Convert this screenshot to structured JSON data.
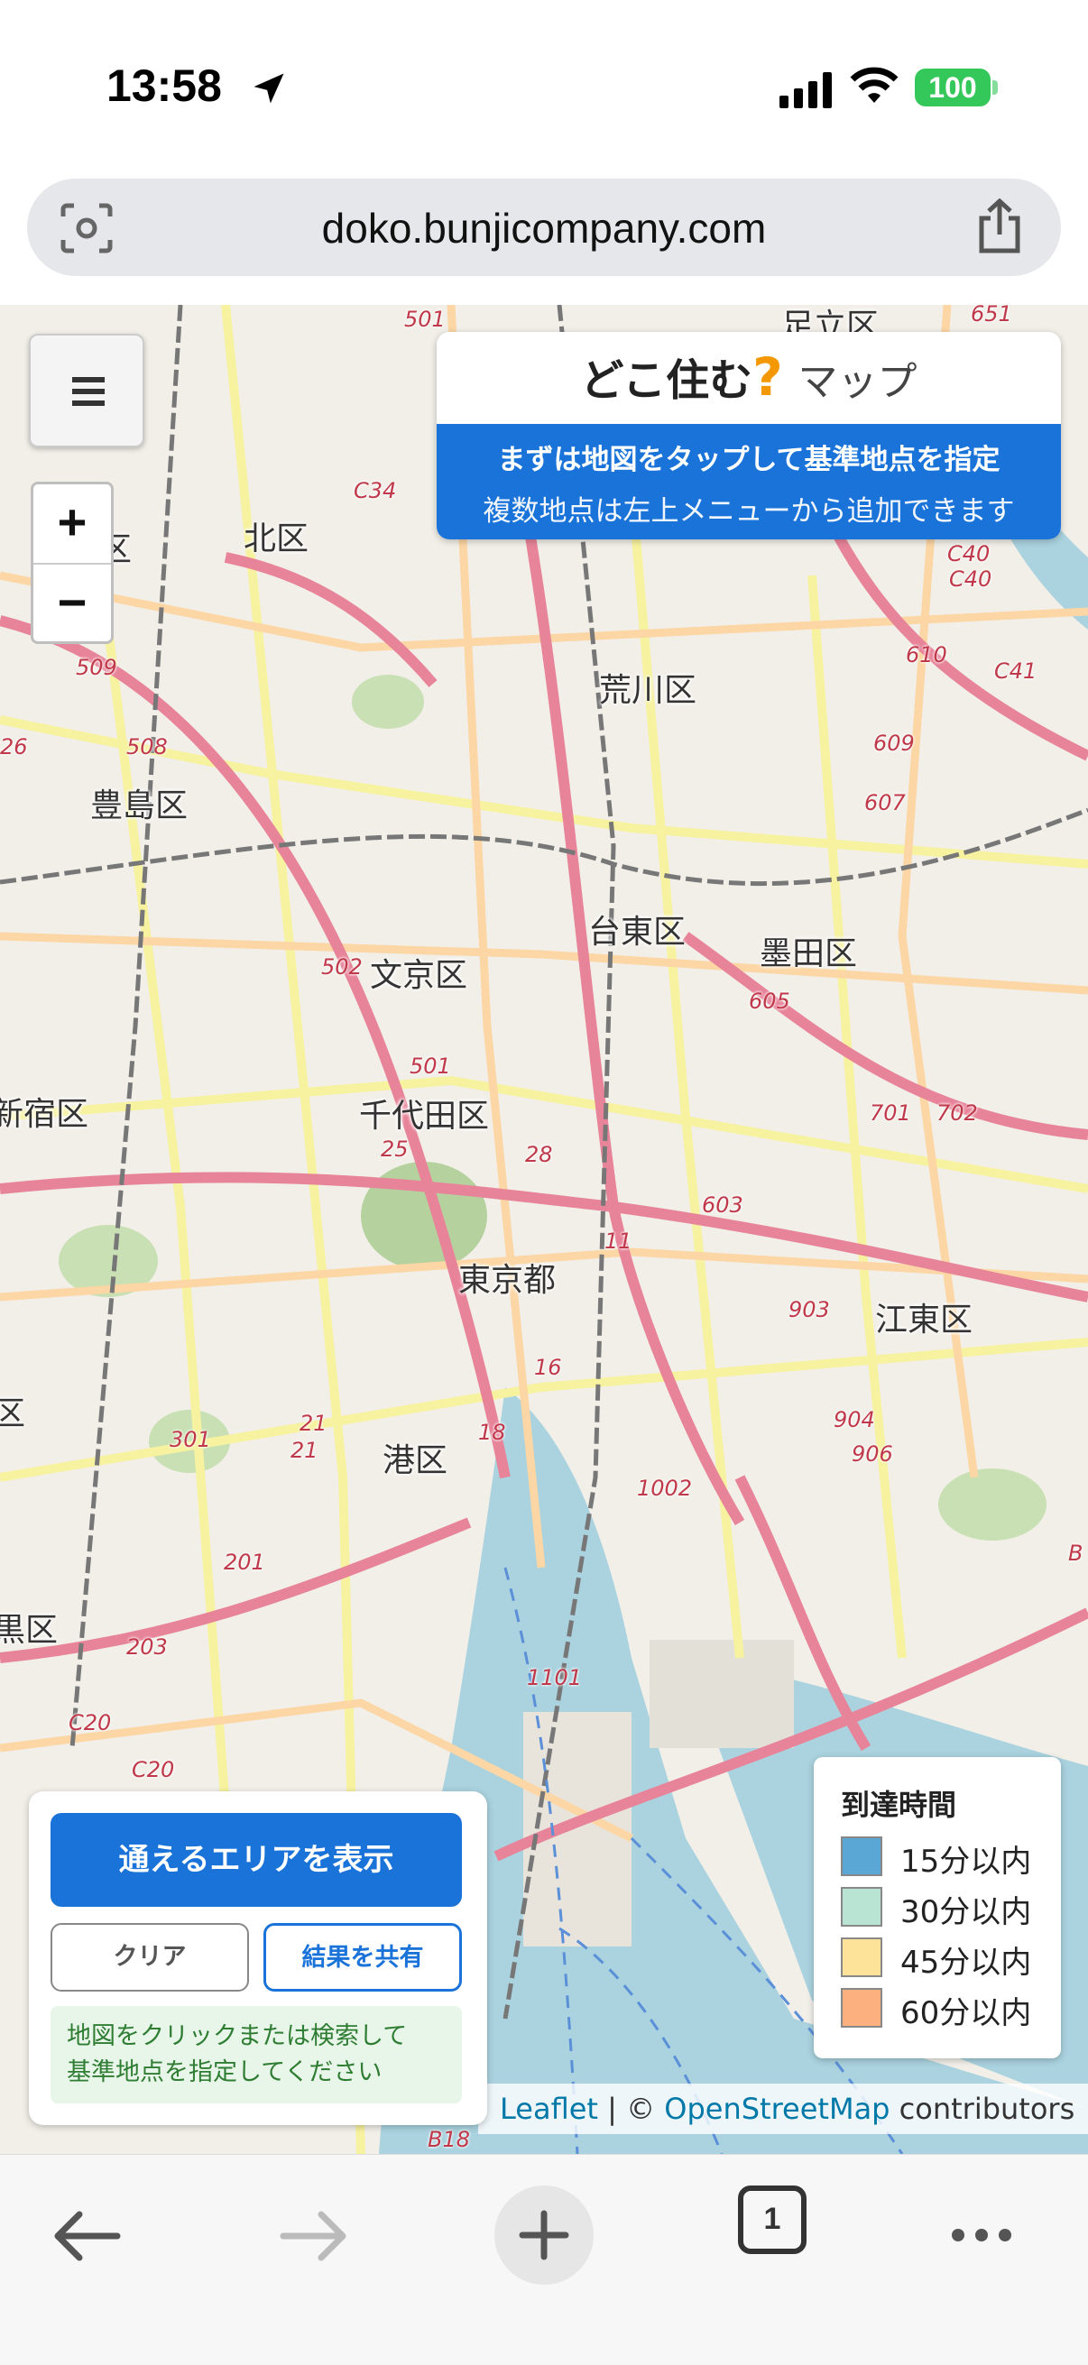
{
  "status_bar": {
    "time": "13:58",
    "battery": "100"
  },
  "browser": {
    "url": "doko.bunjicompany.com",
    "tab_count": "1"
  },
  "map": {
    "place_labels": {
      "adachi": "足立区",
      "kita": "北区",
      "arakawa": "荒川区",
      "toshima": "豊島区",
      "taito": "台東区",
      "sumida": "墨田区",
      "bunkyo": "文京区",
      "shinjuku": "新宿区",
      "chiyoda": "千代田区",
      "tokyo": "東京都",
      "koto": "江東区",
      "minato": "港区",
      "meguro_partial": "黒区",
      "ku_partial": "区",
      "ku_partial2": "区"
    },
    "route_labels": [
      "501",
      "651",
      "C34",
      "C40",
      "C40",
      "610",
      "C41",
      "509",
      "508",
      "609",
      "607",
      "26",
      "502",
      "605",
      "501",
      "701",
      "702",
      "25",
      "28",
      "603",
      "11",
      "903",
      "16",
      "904",
      "906",
      "301",
      "21",
      "21",
      "18",
      "1002",
      "201",
      "203",
      "C20",
      "C20",
      "1101",
      "B18",
      "B"
    ]
  },
  "controls": {
    "zoom_in": "+",
    "zoom_out": "−"
  },
  "title_panel": {
    "title_main": "どこ住む",
    "title_q": "?",
    "title_sub": "マップ",
    "instruction_line1": "まずは地図をタップして基準地点を指定",
    "instruction_line2": "複数地点は左上メニューから追加できます"
  },
  "legend": {
    "title": "到達時間",
    "items": [
      {
        "label": "15分以内",
        "color": "#5aa7d6"
      },
      {
        "label": "30分以内",
        "color": "#b9e3d3"
      },
      {
        "label": "45分以内",
        "color": "#fde29a"
      },
      {
        "label": "60分以内",
        "color": "#fdb07f"
      }
    ]
  },
  "attribution": {
    "leaflet": "Leaflet",
    "separator": " | © ",
    "osm": "OpenStreetMap",
    "contributors": " contributors"
  },
  "action_panel": {
    "show_area_button": "通えるエリアを表示",
    "clear_button": "クリア",
    "share_button": "結果を共有",
    "hint_line1": "地図をクリックまたは検索して",
    "hint_line2": "基準地点を指定してください"
  },
  "colors": {
    "accent": "#1a73d9",
    "hint_bg": "#e8f5e9",
    "hint_text": "#2e7d32",
    "title_q": "#f39800"
  }
}
